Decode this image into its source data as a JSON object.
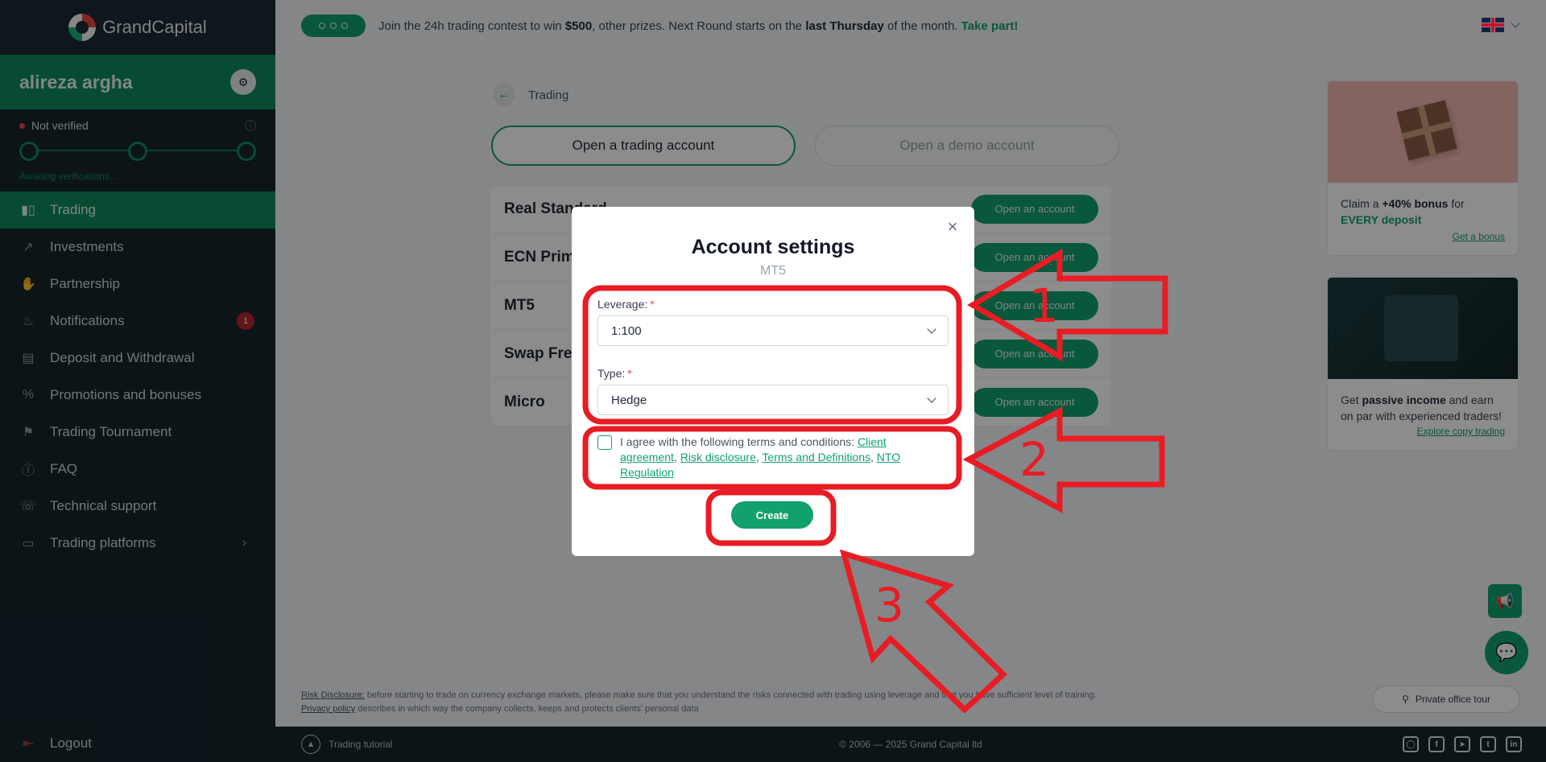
{
  "brand": {
    "name": "GrandCapital"
  },
  "user": {
    "name": "alireza argha"
  },
  "verification": {
    "status": "Not verified",
    "note": "Awaiting verifications..."
  },
  "nav": [
    {
      "label": "Trading",
      "icon": "candles-icon"
    },
    {
      "label": "Investments",
      "icon": "trend-icon"
    },
    {
      "label": "Partnership",
      "icon": "handshake-icon"
    },
    {
      "label": "Notifications",
      "icon": "bell-icon",
      "badge": "1"
    },
    {
      "label": "Deposit and Withdrawal",
      "icon": "card-icon"
    },
    {
      "label": "Promotions and bonuses",
      "icon": "percent-icon"
    },
    {
      "label": "Trading Tournament",
      "icon": "trophy-icon"
    },
    {
      "label": "FAQ",
      "icon": "info-icon"
    },
    {
      "label": "Technical support",
      "icon": "headset-icon"
    },
    {
      "label": "Trading platforms",
      "icon": "monitor-icon"
    }
  ],
  "logout": "Logout",
  "banner": {
    "part1": "Join the 24h trading contest to win ",
    "prize": "$500",
    "part2": ", other prizes. Next Round starts on the ",
    "day": "last Thursday",
    "part3": " of the month. ",
    "cta": "Take part!"
  },
  "breadcrumb": {
    "label": "Trading"
  },
  "tabs": {
    "real": "Open a trading account",
    "demo": "Open a demo account"
  },
  "accounts": [
    {
      "name": "Real Standard",
      "button": "Open an account"
    },
    {
      "name": "ECN Prime",
      "button": "Open an account"
    },
    {
      "name": "MT5",
      "button": "Open an account"
    },
    {
      "name": "Swap Free",
      "button": "Open an account"
    },
    {
      "name": "Micro",
      "button": "Open an account"
    }
  ],
  "promo1": {
    "pre": "Claim a ",
    "bold": "+40% bonus",
    "mid": " for ",
    "green": "EVERY deposit",
    "link": "Get a bonus"
  },
  "promo2": {
    "pre": "Get ",
    "bold": "passive income",
    "post": " and earn on par with experienced traders!",
    "link": "Explore copy trading"
  },
  "disclosure": {
    "risk_link": "Risk Disclosure:",
    "risk_text": " before starting to trade on currency exchange markets, please make sure that you understand the risks connected with trading using leverage and that you have sufficient level of training.",
    "privacy_link": "Privacy policy",
    "privacy_text": " describes in which way the company collects, keeps and protects clients' personal data"
  },
  "tour": "Private office tour",
  "footer": {
    "tutorial": "Trading tutorial",
    "copyright": "© 2006 — 2025 Grand Capital ltd"
  },
  "modal": {
    "title": "Account settings",
    "subtitle": "MT5",
    "leverage_label": "Leverage:",
    "leverage_value": "1:100",
    "type_label": "Type:",
    "type_value": "Hedge",
    "terms_prefix": "I agree with the following terms and conditions: ",
    "links": [
      "Client agreement",
      "Risk disclosure",
      "Terms and Definitions",
      "NTO Regulation"
    ],
    "create": "Create"
  },
  "annotations": {
    "n1": "1",
    "n2": "2",
    "n3": "3"
  },
  "colors": {
    "accent": "#12a06c",
    "sidebar": "#17252d",
    "annotation": "#e81c24"
  }
}
